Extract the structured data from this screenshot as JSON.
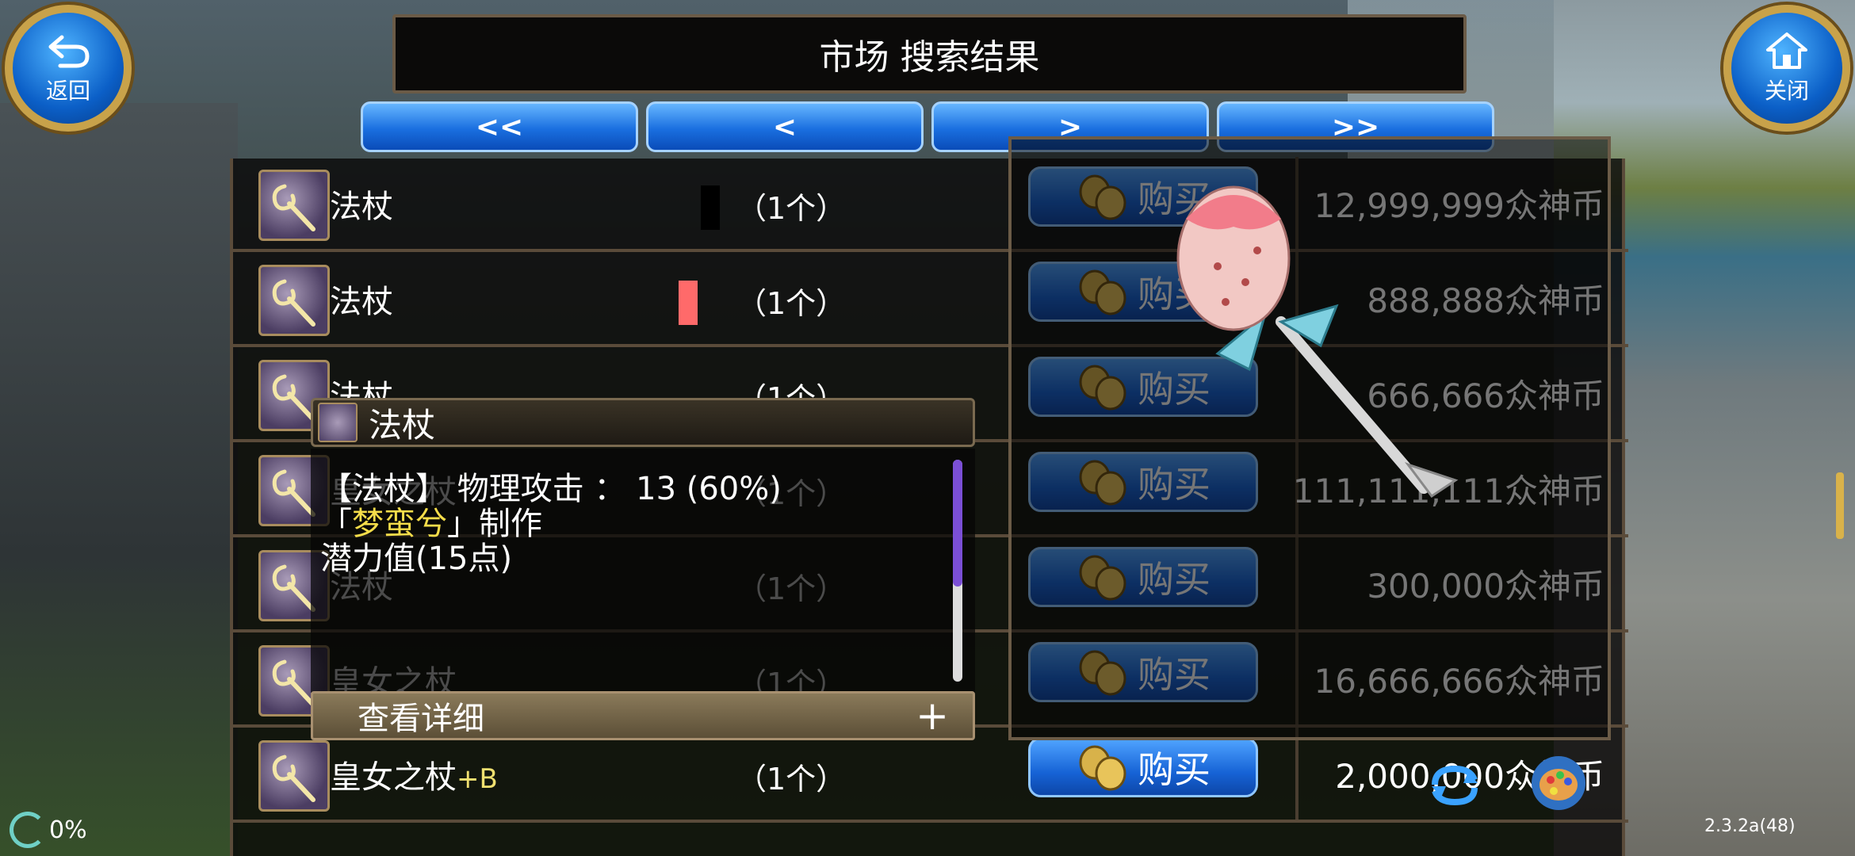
{
  "window": {
    "title": "市场 搜索结果"
  },
  "corner_buttons": {
    "back": "返回",
    "close": "关闭"
  },
  "pagination": {
    "first": "<<",
    "prev": "<",
    "next": ">",
    "last": ">>"
  },
  "rows": [
    {
      "name": "法杖",
      "plus": "",
      "qty": "（1个）",
      "buy": "购买",
      "price": "12,999,999众神币"
    },
    {
      "name": "法杖",
      "plus": "",
      "qty": "（1个）",
      "buy": "购买",
      "price": "888,888众神币"
    },
    {
      "name": "法杖",
      "plus": "",
      "qty": "（1个）",
      "buy": "购买",
      "price": "666,666众神币"
    },
    {
      "name": "皇女之杖",
      "plus": "",
      "qty": "（1个）",
      "buy": "购买",
      "price": "111,111,111众神币"
    },
    {
      "name": "法杖",
      "plus": "",
      "qty": "（1个）",
      "buy": "购买",
      "price": "300,000众神币"
    },
    {
      "name": "皇女之杖",
      "plus": "",
      "qty": "（1个）",
      "buy": "购买",
      "price": "16,666,666众神币"
    },
    {
      "name": "皇女之杖",
      "plus": "+B",
      "qty": "（1个）",
      "buy": "购买",
      "price": "2,000,000众神币"
    }
  ],
  "tooltip": {
    "title": "法杖",
    "line1": "【法杖】 物理攻击 ： 13 (60%)",
    "maker_prefix": "「",
    "maker_name": "梦蛮兮",
    "maker_suffix": "」制作",
    "line3": "潜力值(15点)",
    "detail_button": "查看详细",
    "detail_plus": "+"
  },
  "status": {
    "progress": "0%",
    "version": "2.3.2a(48)"
  },
  "colors": {
    "buy_button": "#1a6fe0",
    "maker_name": "#f5dd4a",
    "plus_label": "#f0e070",
    "frame": "#6b5b47"
  },
  "icons": [
    "staff-icon",
    "coin-icon",
    "back-arrow-icon",
    "home-icon",
    "refresh-icon",
    "palette-icon"
  ]
}
